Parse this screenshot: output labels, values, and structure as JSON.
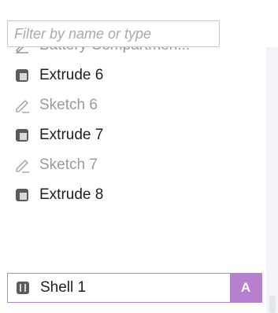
{
  "filter": {
    "placeholder": "Filter by name or type",
    "value": ""
  },
  "items": [
    {
      "label": "Battery Compartmen...",
      "type": "sketch",
      "icon": "sketch-icon"
    },
    {
      "label": "Extrude 6",
      "type": "feature",
      "icon": "extrude-icon"
    },
    {
      "label": "Sketch 6",
      "type": "sketch",
      "icon": "sketch-icon"
    },
    {
      "label": "Extrude 7",
      "type": "feature",
      "icon": "extrude-icon"
    },
    {
      "label": "Sketch 7",
      "type": "sketch",
      "icon": "sketch-icon"
    },
    {
      "label": "Extrude 8",
      "type": "feature",
      "icon": "extrude-icon"
    },
    {
      "label": "Shell 1",
      "type": "feature",
      "icon": "shell-icon",
      "selected": true,
      "badge": "A"
    }
  ],
  "colors": {
    "selection": "#b680cf",
    "selection_border": "#b583c9",
    "sketch_text": "#9a9a9a",
    "feature_text": "#1f1f1f"
  }
}
